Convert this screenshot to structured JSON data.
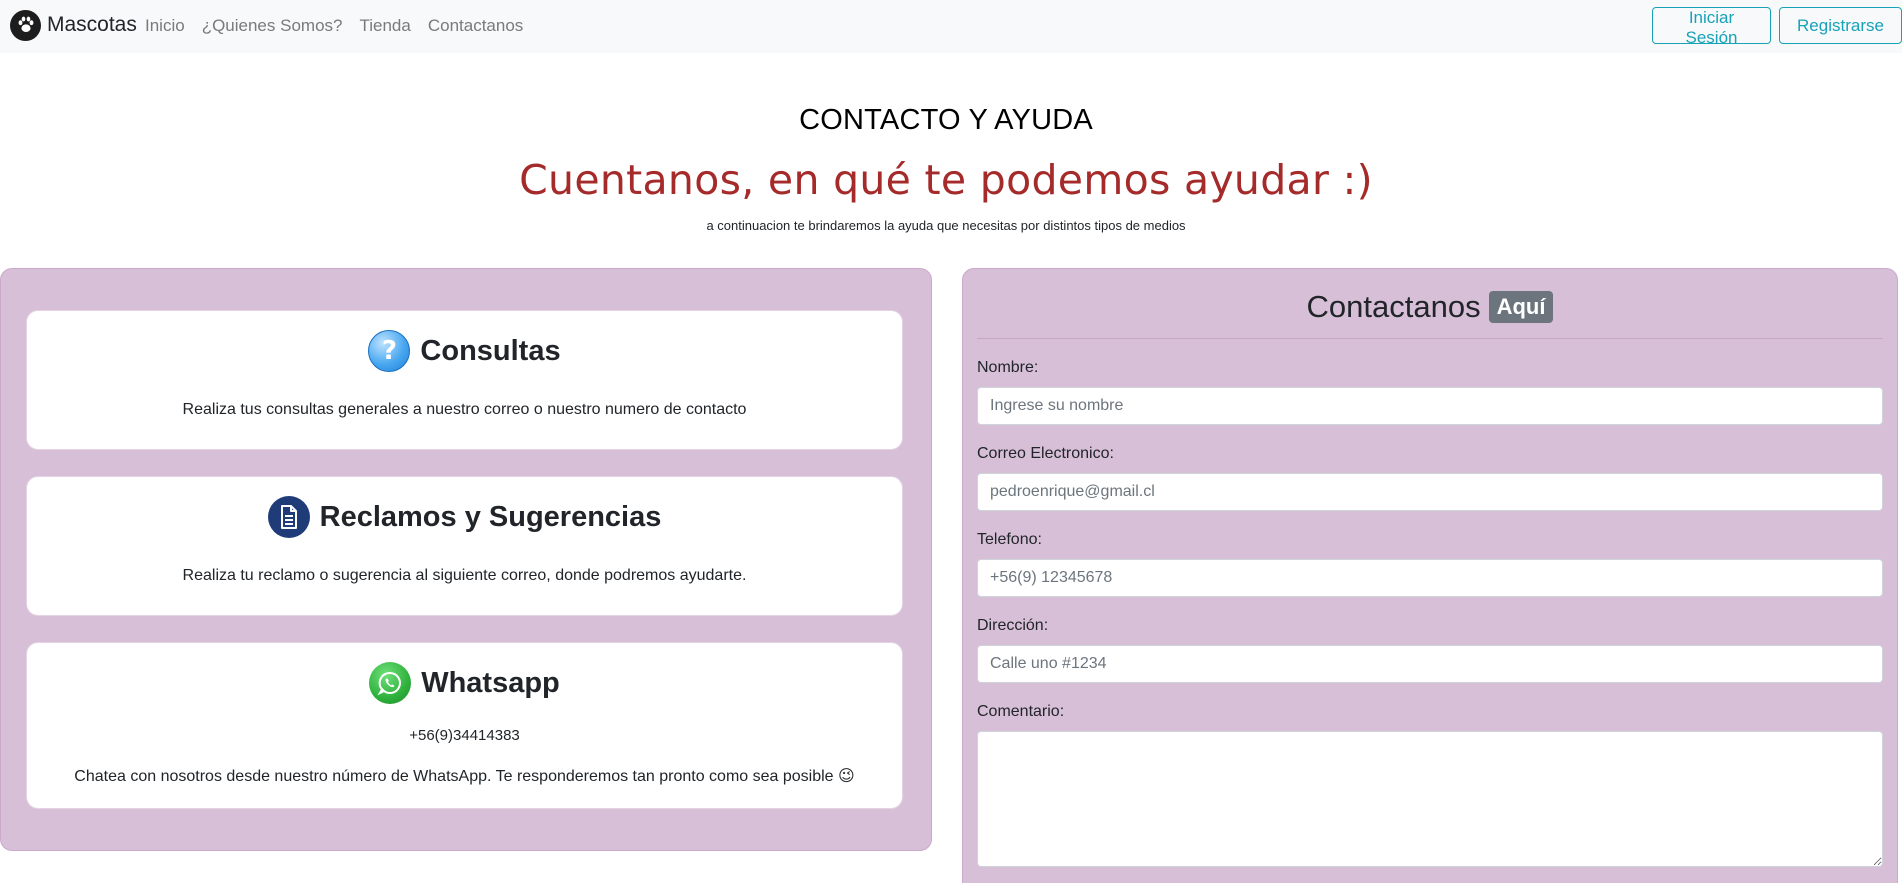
{
  "navbar": {
    "brand": "Mascotas",
    "links": [
      "Inicio",
      "¿Quienes Somos?",
      "Tienda",
      "Contactanos"
    ],
    "login_label": "Iniciar Sesión",
    "register_label": "Registrarse"
  },
  "header": {
    "title": "CONTACTO Y AYUDA",
    "subtitle": "Cuentanos, en qué te podemos ayudar :)",
    "description": "a continuacion te brindaremos la ayuda que necesitas por distintos tipos de medios"
  },
  "cards": [
    {
      "icon": "question-icon",
      "title": "Consultas",
      "text": "Realiza tus consultas generales a nuestro correo o nuestro numero de contacto"
    },
    {
      "icon": "document-icon",
      "title": "Reclamos y Sugerencias",
      "text": "Realiza tu reclamo o sugerencia al siguiente correo, donde podremos ayudarte."
    },
    {
      "icon": "whatsapp-icon",
      "title": "Whatsapp",
      "phone": "+56(9)34414383",
      "text": "Chatea con nosotros desde nuestro número de WhatsApp. Te responderemos tan pronto como sea posible 😉"
    }
  ],
  "form": {
    "title": "Contactanos",
    "badge": "Aquí",
    "fields": {
      "name": {
        "label": "Nombre:",
        "placeholder": "Ingrese su nombre"
      },
      "email": {
        "label": "Correo Electronico:",
        "placeholder": "pedroenrique@gmail.cl"
      },
      "phone": {
        "label": "Telefono:",
        "placeholder": "+56(9) 12345678"
      },
      "address": {
        "label": "Dirección:",
        "placeholder": "Calle uno #1234"
      },
      "comment": {
        "label": "Comentario:",
        "placeholder": ""
      }
    }
  },
  "colors": {
    "panel": "#d8bfd8",
    "subtitle": "#a52a2a",
    "button_outline": "#17a2b8",
    "badge": "#6c757d"
  }
}
